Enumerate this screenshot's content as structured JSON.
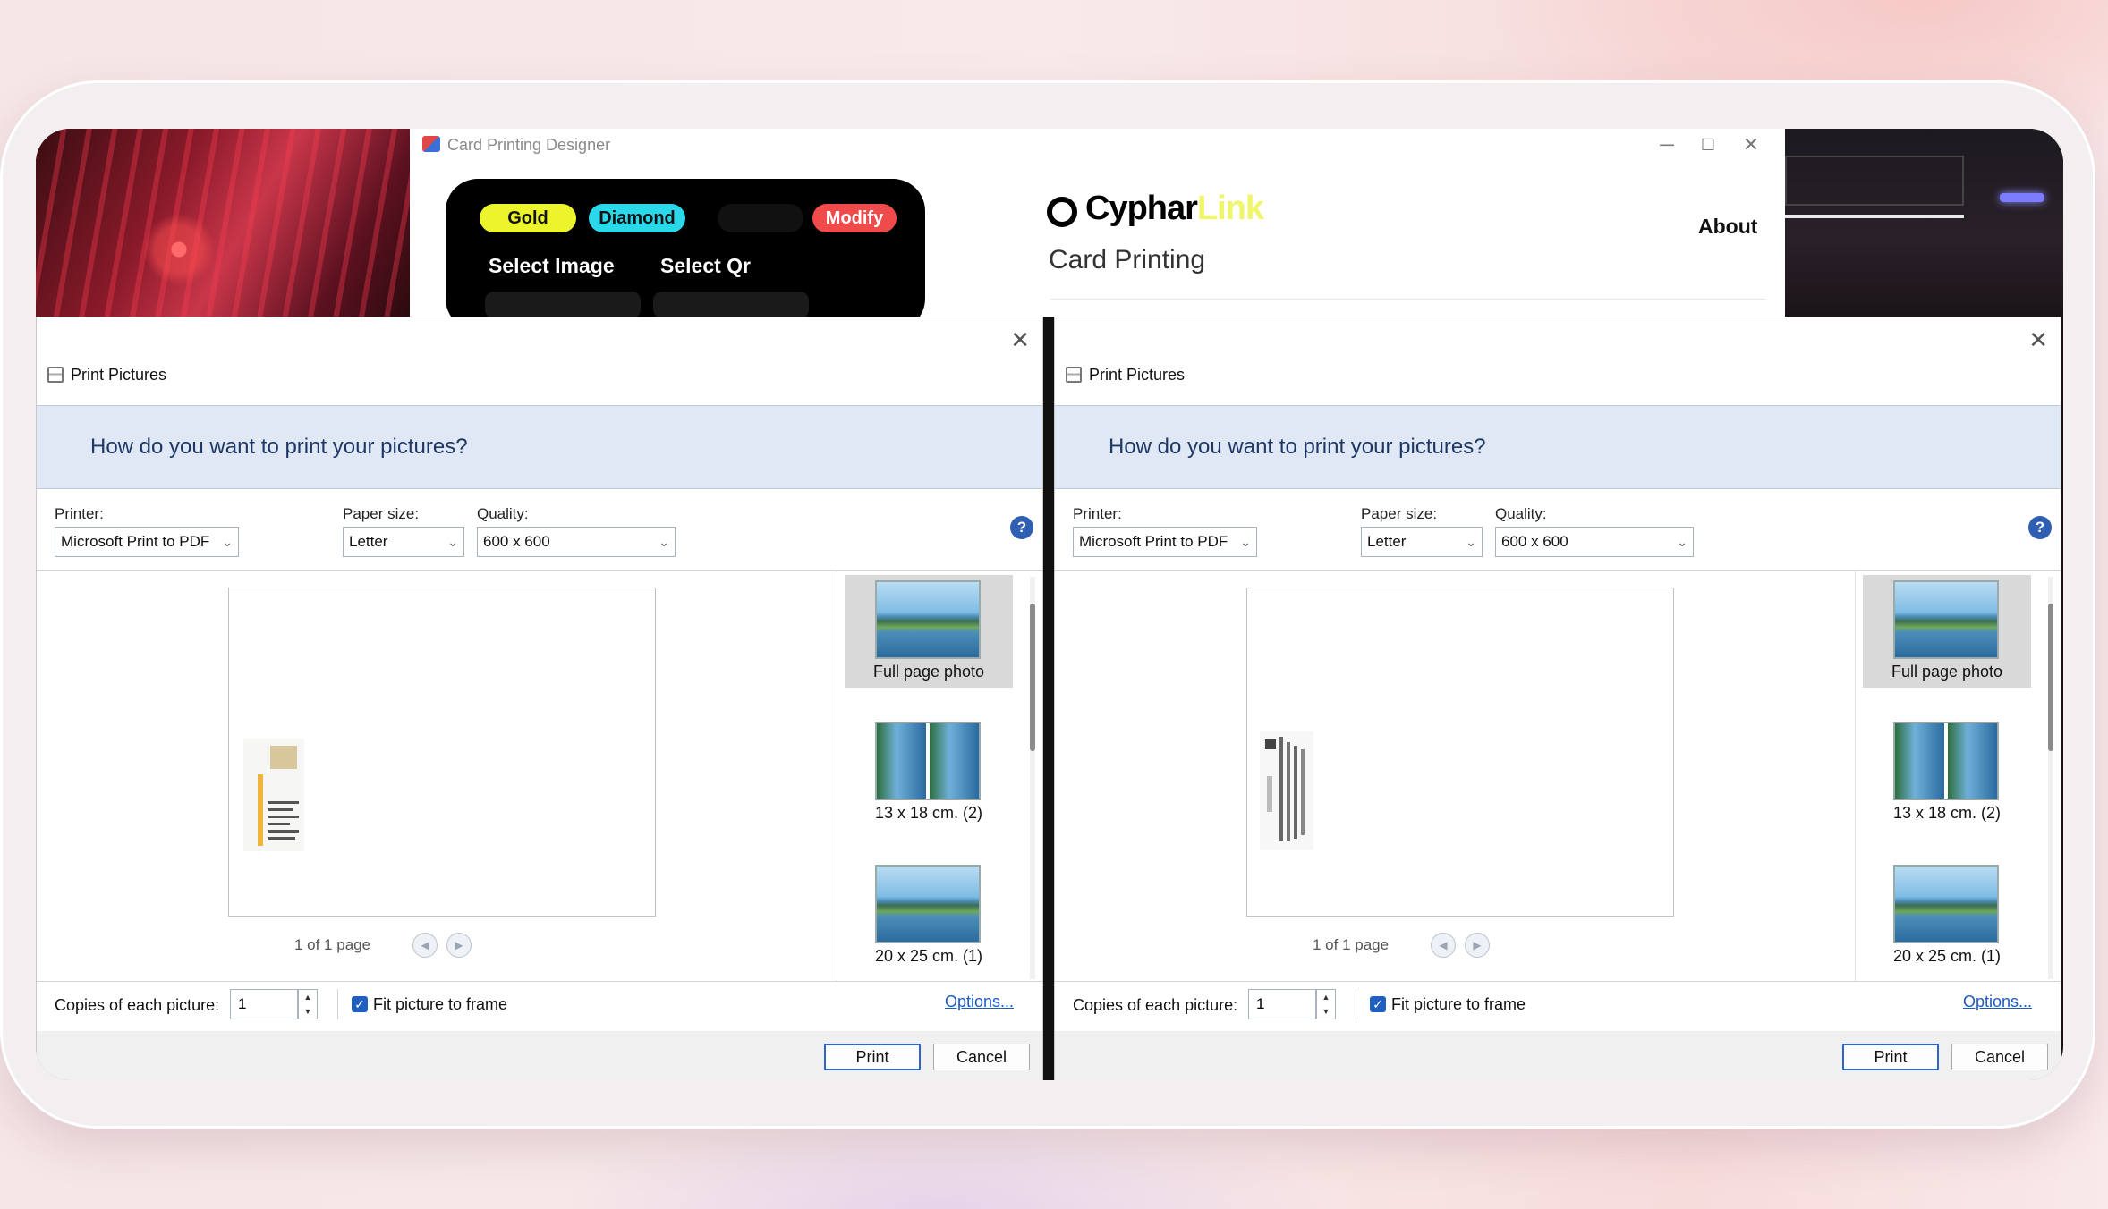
{
  "designer": {
    "title": "Card Printing Designer",
    "pills": {
      "gold": "Gold",
      "diamond": "Diamond",
      "modify": "Modify"
    },
    "select_image": "Select Image",
    "select_qr": "Select Qr",
    "brand_part1": "Cyphar",
    "brand_part2": "Link",
    "subtitle": "Card Printing",
    "about": "About",
    "window_controls": {
      "minimize": "─",
      "maximize": "☐",
      "close": "✕"
    }
  },
  "dialogs": [
    {
      "title": "Print Pictures",
      "question": "How do you want to print your pictures?",
      "printer_label": "Printer:",
      "printer_value": "Microsoft Print to PDF",
      "paper_label": "Paper size:",
      "paper_value": "Letter",
      "quality_label": "Quality:",
      "quality_value": "600 x 600",
      "help": "?",
      "page_count": "1 of 1 page",
      "layouts": [
        "Full page photo",
        "13 x 18 cm. (2)",
        "20 x 25 cm. (1)"
      ],
      "copies_label": "Copies of each picture:",
      "copies_value": "1",
      "fit_label": "Fit picture to frame",
      "fit_checked": true,
      "options": "Options...",
      "print": "Print",
      "cancel": "Cancel",
      "close": "✕"
    },
    {
      "title": "Print Pictures",
      "question": "How do you want to print your pictures?",
      "printer_label": "Printer:",
      "printer_value": "Microsoft Print to PDF",
      "paper_label": "Paper size:",
      "paper_value": "Letter",
      "quality_label": "Quality:",
      "quality_value": "600 x 600",
      "help": "?",
      "page_count": "1 of 1 page",
      "layouts": [
        "Full page photo",
        "13 x 18 cm. (2)",
        "20 x 25 cm. (1)"
      ],
      "copies_label": "Copies of each picture:",
      "copies_value": "1",
      "fit_label": "Fit picture to frame",
      "fit_checked": true,
      "options": "Options...",
      "print": "Print",
      "cancel": "Cancel",
      "close": "✕"
    }
  ],
  "colors": {
    "accent_blue": "#1f5fbf",
    "band": "#dfe8f4",
    "gold_pill": "#ecf52b",
    "diamond_pill": "#2ad8ea",
    "modify_pill": "#ef4b4b",
    "brand_link": "#f0f66a"
  }
}
